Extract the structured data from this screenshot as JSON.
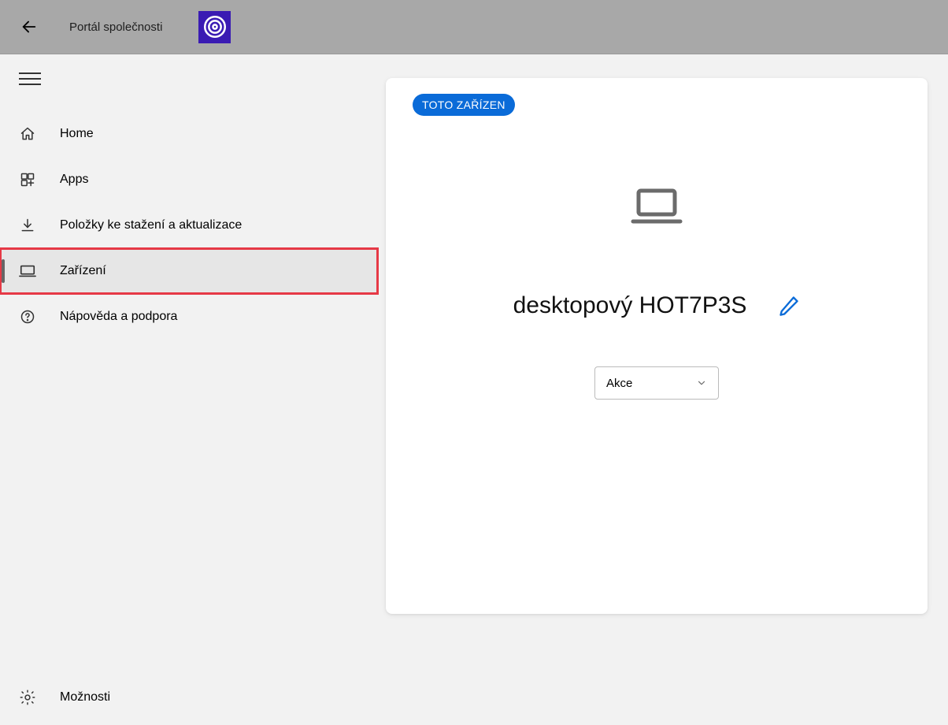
{
  "header": {
    "app_title": "Portál společnosti"
  },
  "sidebar": {
    "items": [
      {
        "icon": "home",
        "label": "Home"
      },
      {
        "icon": "apps",
        "label": "Apps"
      },
      {
        "icon": "download",
        "label": "Položky ke stažení a aktualizace"
      },
      {
        "icon": "device",
        "label": "Zařízení"
      },
      {
        "icon": "help",
        "label": "Nápověda a podpora"
      }
    ],
    "settings_label": "Možnosti"
  },
  "main": {
    "badge": "TOTO ZAŘÍZEN",
    "device_name": "desktopový HOT7P3S",
    "action_dropdown": "Akce"
  }
}
